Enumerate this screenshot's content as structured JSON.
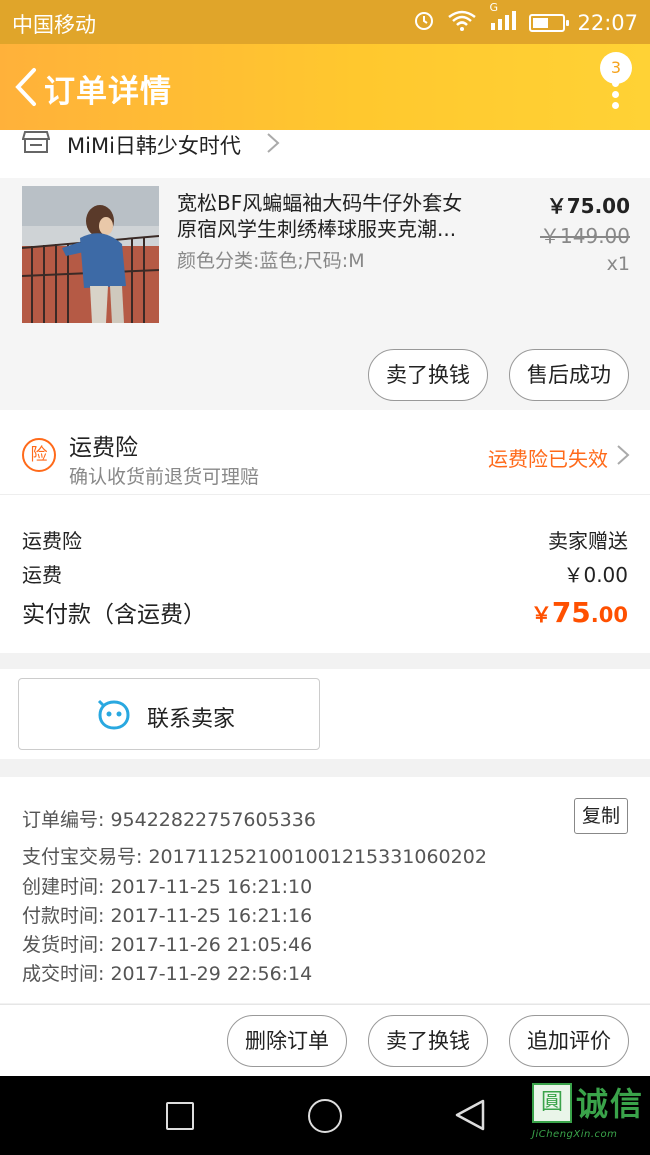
{
  "status_bar": {
    "carrier": "中国移动",
    "network": "G",
    "time": "22:07",
    "battery_level": 0.55
  },
  "header": {
    "title": "订单详情",
    "badge_count": "3",
    "icons": [
      "back-arrow-icon",
      "more-dots-icon"
    ]
  },
  "shop": {
    "name": "MiMi日韩少女时代",
    "icon": "store-icon"
  },
  "product": {
    "name_line1": "宽松BF风蝙蝠袖大码牛仔外套女",
    "name_line2": "原宿风学生刺绣棒球服夹克潮...",
    "spec": "颜色分类:蓝色;尺码:M",
    "price": "￥75.00",
    "original_price": "￥149.00",
    "quantity": "x1",
    "buttons": {
      "sell": "卖了换钱",
      "after_sale": "售后成功"
    }
  },
  "insurance": {
    "icon_text": "险",
    "title": "运费险",
    "subtitle": "确认收货前退货可理赔",
    "status": "运费险已失效"
  },
  "costs": {
    "insurance_label": "运费险",
    "insurance_value": "卖家赠送",
    "shipping_label": "运费",
    "shipping_value": "￥0.00",
    "total_label": "实付款（含运费）",
    "total_currency": "￥",
    "total_int": "75",
    "total_dec": ".00"
  },
  "contact": {
    "label": "联系卖家"
  },
  "order_info": {
    "order_no": "订单编号: 95422822757605336",
    "copy": "复制",
    "alipay_no": "支付宝交易号: 2017112521001001215331060202",
    "created": "创建时间: 2017-11-25 16:21:10",
    "paid": "付款时间: 2017-11-25 16:21:16",
    "shipped": "发货时间: 2017-11-26 21:05:46",
    "closed": "成交时间: 2017-11-29 22:56:14"
  },
  "actions": {
    "delete": "删除订单",
    "sell": "卖了换钱",
    "review": "追加评价"
  },
  "watermark": {
    "mark": "圓",
    "text": "诚信",
    "sub": "JiChengXin.com"
  },
  "colors": {
    "accent": "#ff5000",
    "header_start": "#ffb13a",
    "header_end": "#ffd235",
    "insurance": "#ff6a1a"
  }
}
